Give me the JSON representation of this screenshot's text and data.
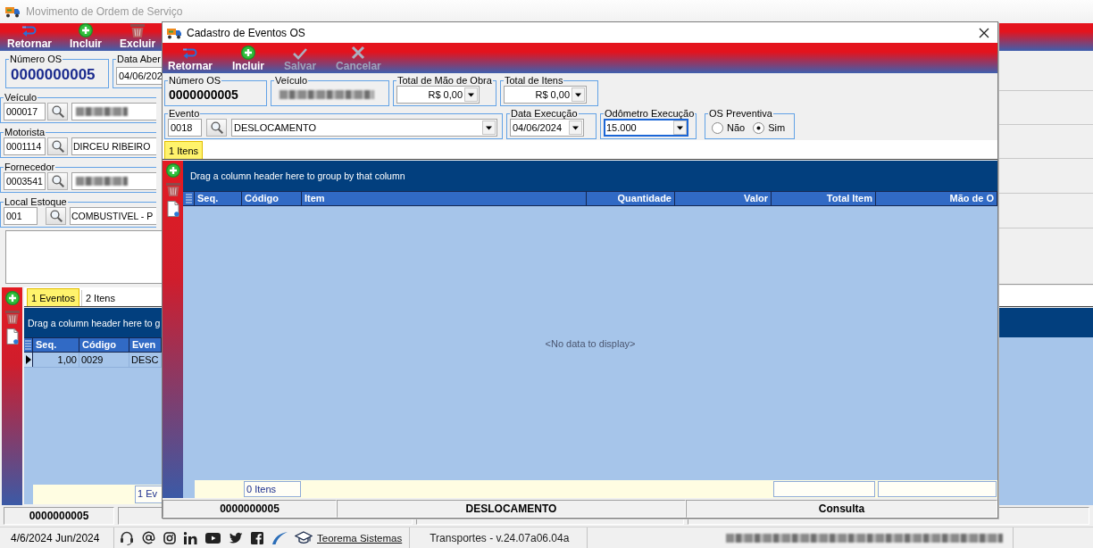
{
  "background_window": {
    "title": "Movimento de Ordem de Serviço",
    "toolbar": [
      {
        "label": "Retornar",
        "kind": "back",
        "disabled": false
      },
      {
        "label": "Incluir",
        "kind": "add",
        "disabled": false
      },
      {
        "label": "Excluir",
        "kind": "delete",
        "disabled": false
      }
    ],
    "numero_os": {
      "label": "Número OS",
      "value": "0000000005"
    },
    "data_abertura": {
      "label": "Data Aber",
      "value": "04/06/202"
    },
    "lookups": [
      {
        "label": "Veículo",
        "code": "000017",
        "redacted": true
      },
      {
        "label": "Motorista",
        "code": "0001114",
        "name": "DIRCEU RIBEIRO",
        "redacted": false
      },
      {
        "label": "Fornecedor",
        "code": "0003541",
        "redacted": true
      },
      {
        "label": "Local Estoque",
        "code": "001",
        "name": "COMBUSTIVEL - P",
        "redacted": false
      }
    ],
    "tabs": [
      {
        "label": "1 Eventos",
        "selected": true
      },
      {
        "label": "2 Itens",
        "selected": false
      }
    ],
    "grid": {
      "group_hint": "Drag a column header here to g",
      "columns": [
        {
          "label": "Seq.",
          "kind": "seq",
          "footer_box": false
        },
        {
          "label": "Código",
          "kind": "text",
          "footer_box": false
        },
        {
          "label": "Even",
          "kind": "text",
          "footer_box": true,
          "footer_text": "1 Ev"
        }
      ],
      "rows": [
        {
          "selected": true,
          "cells": [
            "1,00",
            "0029",
            "DESC"
          ]
        }
      ]
    },
    "status_bar": [
      "0000000005"
    ]
  },
  "modal": {
    "title": "Cadastro de Eventos OS",
    "toolbar": [
      {
        "label": "Retornar",
        "kind": "back",
        "disabled": false
      },
      {
        "label": "Incluir",
        "kind": "add",
        "disabled": false
      },
      {
        "label": "Salvar",
        "kind": "save",
        "disabled": true
      },
      {
        "label": "Cancelar",
        "kind": "cancel",
        "disabled": true
      }
    ],
    "numero_os": {
      "label": "Número OS",
      "value": "0000000005"
    },
    "veiculo": {
      "label": "Veículo",
      "redacted": true
    },
    "total_mao_de_obra": {
      "label": "Total de Mão de Obra",
      "value": "R$ 0,00"
    },
    "total_itens": {
      "label": "Total de Itens",
      "value": "R$ 0,00"
    },
    "evento": {
      "label": "Evento",
      "code": "0018",
      "name": "DESLOCAMENTO"
    },
    "data_execucao": {
      "label": "Data Execução",
      "value": "04/06/2024"
    },
    "odometro_execucao": {
      "label": "Odômetro Execução",
      "value": "15.000",
      "focused": true
    },
    "os_preventiva": {
      "label": "OS Preventiva",
      "options": [
        {
          "label": "Não",
          "selected": false
        },
        {
          "label": "Sim",
          "selected": true
        }
      ]
    },
    "tabs": [
      {
        "label": "1 Itens",
        "selected": true
      }
    ],
    "grid": {
      "group_hint": "Drag a column header here to group by that column",
      "columns": [
        {
          "label": "Seq.",
          "kind": "seq",
          "footer_box": false
        },
        {
          "label": "Código",
          "kind": "text",
          "footer_box": true,
          "footer_text": "0 Itens"
        },
        {
          "label": "Item",
          "kind": "text",
          "footer_box": false
        },
        {
          "label": "Quantidade",
          "kind": "number",
          "footer_box": false
        },
        {
          "label": "Valor",
          "kind": "number",
          "footer_box": false
        },
        {
          "label": "Total Item",
          "kind": "number",
          "footer_box": true
        },
        {
          "label": "Mão de O",
          "kind": "number",
          "footer_box": true
        }
      ],
      "empty_text": "<No data to display>"
    },
    "status_bar": [
      "0000000005",
      "DESLOCAMENTO",
      "Consulta"
    ]
  },
  "bottom_bar": {
    "date": "4/6/2024 Jun/2024",
    "link": "Teorema Sistemas",
    "version": "Transportes - v.24.07a06.04a",
    "company_redacted": true
  }
}
